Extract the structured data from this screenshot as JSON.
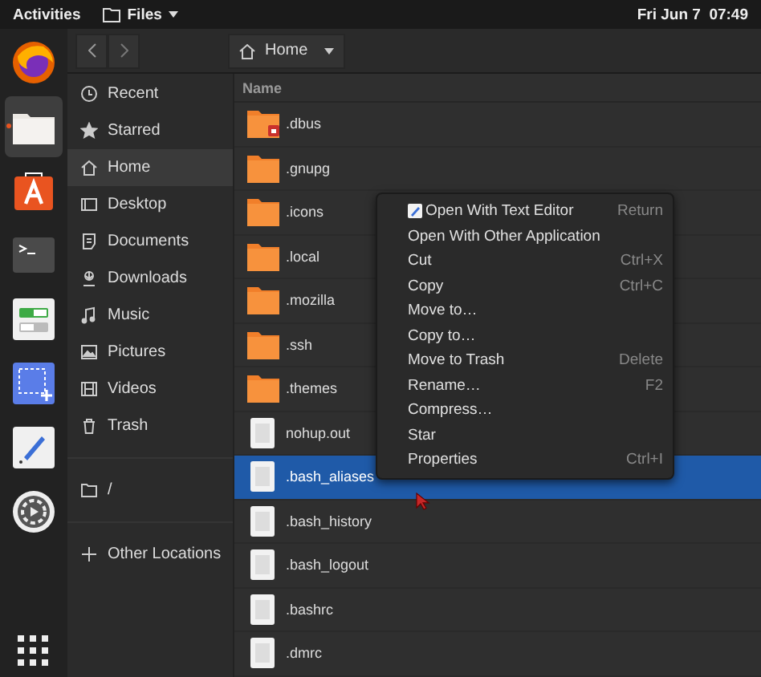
{
  "top_bar": {
    "activities": "Activities",
    "app_menu": "Files",
    "clock": "Fri Jun 7  07:49"
  },
  "dock": [
    {
      "selected": false
    },
    {
      "selected": true
    },
    {
      "selected": false
    },
    {
      "selected": false
    },
    {
      "selected": false
    },
    {
      "selected": false
    },
    {
      "selected": false
    },
    {
      "selected": false
    }
  ],
  "header": {
    "path": "Home"
  },
  "sidebar": {
    "items": [
      {
        "label": "Recent",
        "selected": false
      },
      {
        "label": "Starred",
        "selected": false
      },
      {
        "label": "Home",
        "selected": true
      },
      {
        "label": "Desktop",
        "selected": false
      },
      {
        "label": "Documents",
        "selected": false
      },
      {
        "label": "Downloads",
        "selected": false
      },
      {
        "label": "Music",
        "selected": false
      },
      {
        "label": "Pictures",
        "selected": false
      },
      {
        "label": "Videos",
        "selected": false
      },
      {
        "label": "Trash",
        "selected": false
      }
    ],
    "devices": [
      {
        "label": "/"
      }
    ],
    "other": {
      "label": "Other Locations"
    }
  },
  "files": {
    "column": "Name",
    "rows": [
      {
        "name": ".dbus",
        "kind": "folder",
        "locked": true,
        "selected": false
      },
      {
        "name": ".gnupg",
        "kind": "folder",
        "locked": false,
        "selected": false
      },
      {
        "name": ".icons",
        "kind": "folder",
        "locked": false,
        "selected": false
      },
      {
        "name": ".local",
        "kind": "folder",
        "locked": false,
        "selected": false
      },
      {
        "name": ".mozilla",
        "kind": "folder",
        "locked": false,
        "selected": false
      },
      {
        "name": ".ssh",
        "kind": "folder",
        "locked": false,
        "selected": false
      },
      {
        "name": ".themes",
        "kind": "folder",
        "locked": false,
        "selected": false
      },
      {
        "name": "nohup.out",
        "kind": "file",
        "selected": false
      },
      {
        "name": ".bash_aliases",
        "kind": "file",
        "selected": true
      },
      {
        "name": ".bash_history",
        "kind": "file",
        "selected": false
      },
      {
        "name": ".bash_logout",
        "kind": "file",
        "selected": false
      },
      {
        "name": ".bashrc",
        "kind": "file",
        "selected": false
      },
      {
        "name": ".dmrc",
        "kind": "file",
        "selected": false
      }
    ]
  },
  "context_menu": [
    {
      "label": "Open With Text Editor",
      "shortcut": "Return"
    },
    {
      "label": "Open With Other Application"
    },
    {
      "label": "Cut",
      "shortcut": "Ctrl+X"
    },
    {
      "label": "Copy",
      "shortcut": "Ctrl+C"
    },
    {
      "label": "Move to…"
    },
    {
      "label": "Copy to…"
    },
    {
      "label": "Move to Trash",
      "shortcut": "Delete"
    },
    {
      "label": "Rename…",
      "shortcut": "F2"
    },
    {
      "label": "Compress…"
    },
    {
      "label": "Star"
    },
    {
      "label": "Properties",
      "shortcut": "Ctrl+I"
    }
  ]
}
